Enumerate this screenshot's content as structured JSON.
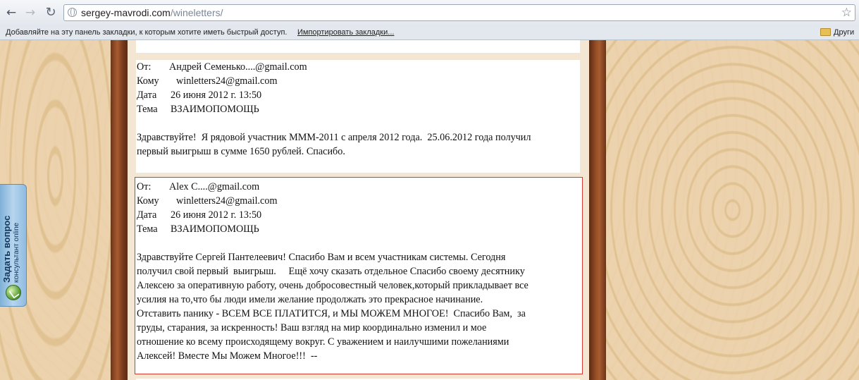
{
  "browser": {
    "url_domain": "sergey-mavrodi.com",
    "url_path": "/wineletters/",
    "bookmarks_prompt": "Добавляйте на эту панель закладки, к которым хотите иметь быстрый доступ.",
    "import_link": "Импортировать закладки...",
    "other_bookmarks": "Други",
    "icons": [
      "back-arrow-icon",
      "forward-arrow-icon",
      "reload-icon",
      "globe-icon",
      "star-icon",
      "folder-icon"
    ]
  },
  "letters": [
    {
      "from_label": "От:",
      "from": "Андрей Семенько....@gmail.com",
      "to_label": "Кому",
      "to": "winletters24@gmail.com",
      "date_label": "Дата",
      "date": "26 июня 2012 г. 13:50",
      "subject_label": "Тема",
      "subject": "ВЗАИМОПОМОЩЬ",
      "body_lines": [
        "Здравствуйте!  Я рядовой участник МММ-2011 с апреля 2012 года.  25.06.2012 года получил",
        "первый выигрыш в сумме 1650 рублей. Спасибо."
      ]
    },
    {
      "from_label": "От:",
      "from": "Alex C....@gmail.com",
      "to_label": "Кому",
      "to": "winletters24@gmail.com",
      "date_label": "Дата",
      "date": "26 июня 2012 г. 13:50",
      "subject_label": "Тема",
      "subject": "ВЗАИМОПОМОЩЬ",
      "body_lines": [
        "Здравствуйте Сергей Пантелеевич! Спасибо Вам и всем участникам системы. Сегодня",
        "получил свой первый  выигрыш.     Ещё хочу сказать отдельное Спасибо своему десятнику",
        "Алексею за оперативную работу, очень добросовестный человек,который прикладывает все",
        "усилия на то,что бы люди имели желание продолжать это прекрасное начинание.",
        "Отставить панику - ВСЕМ ВСЕ ПЛАТИТСЯ, и МЫ МОЖЕМ МНОГОЕ!  Спасибо Вам,  за",
        "труды, старания, за искренность! Ваш взгляд на мир координально изменил и мое",
        "отношение ко всему происходящему вокруг. С уважением и наилучшими пожеланиями",
        "Алексей! Вместе Мы Можем Многое!!!  --"
      ]
    }
  ],
  "widget": {
    "title": "Задать вопрос",
    "subtitle": "консультант online",
    "icon": "consultant-icon"
  }
}
